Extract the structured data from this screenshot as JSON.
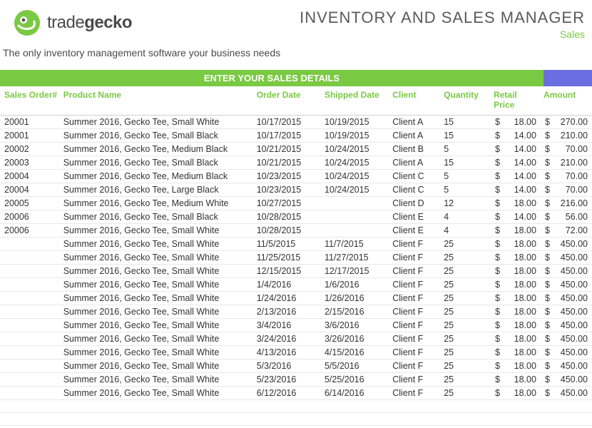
{
  "brand": {
    "name_light": "trade",
    "name_bold": "gecko",
    "tagline": "The only inventory management software your business needs"
  },
  "header": {
    "title": "INVENTORY AND SALES MANAGER",
    "subtitle": "Sales"
  },
  "table": {
    "section_label": "ENTER YOUR SALES DETAILS",
    "columns": {
      "order": "Sales Order#",
      "product": "Product Name",
      "order_date": "Order Date",
      "shipped_date": "Shipped Date",
      "client": "Client",
      "quantity": "Quantity",
      "retail_price": "Retail Price",
      "amount": "Amount"
    },
    "currency": "$",
    "rows": [
      {
        "order": "20001",
        "product": "Summer 2016, Gecko Tee, Small White",
        "order_date": "10/17/2015",
        "shipped_date": "10/19/2015",
        "client": "Client A",
        "qty": "15",
        "price": "18.00",
        "amount": "270.00"
      },
      {
        "order": "20001",
        "product": "Summer 2016, Gecko Tee, Small Black",
        "order_date": "10/17/2015",
        "shipped_date": "10/19/2015",
        "client": "Client A",
        "qty": "15",
        "price": "14.00",
        "amount": "210.00"
      },
      {
        "order": "20002",
        "product": "Summer 2016, Gecko Tee, Medium Black",
        "order_date": "10/21/2015",
        "shipped_date": "10/24/2015",
        "client": "Client B",
        "qty": "5",
        "price": "14.00",
        "amount": "70.00"
      },
      {
        "order": "20003",
        "product": "Summer 2016, Gecko Tee, Small Black",
        "order_date": "10/21/2015",
        "shipped_date": "10/24/2015",
        "client": "Client A",
        "qty": "15",
        "price": "14.00",
        "amount": "210.00"
      },
      {
        "order": "20004",
        "product": "Summer 2016, Gecko Tee, Medium Black",
        "order_date": "10/23/2015",
        "shipped_date": "10/24/2015",
        "client": "Client C",
        "qty": "5",
        "price": "14.00",
        "amount": "70.00"
      },
      {
        "order": "20004",
        "product": "Summer 2016, Gecko Tee, Large Black",
        "order_date": "10/23/2015",
        "shipped_date": "10/24/2015",
        "client": "Client C",
        "qty": "5",
        "price": "14.00",
        "amount": "70.00"
      },
      {
        "order": "20005",
        "product": "Summer 2016, Gecko Tee, Medium White",
        "order_date": "10/27/2015",
        "shipped_date": "",
        "client": "Client D",
        "qty": "12",
        "price": "18.00",
        "amount": "216.00"
      },
      {
        "order": "20006",
        "product": "Summer 2016, Gecko Tee, Small Black",
        "order_date": "10/28/2015",
        "shipped_date": "",
        "client": "Client E",
        "qty": "4",
        "price": "14.00",
        "amount": "56.00"
      },
      {
        "order": "20006",
        "product": "Summer 2016, Gecko Tee, Small White",
        "order_date": "10/28/2015",
        "shipped_date": "",
        "client": "Client E",
        "qty": "4",
        "price": "18.00",
        "amount": "72.00"
      },
      {
        "order": "",
        "product": "Summer 2016, Gecko Tee, Small White",
        "order_date": "11/5/2015",
        "shipped_date": "11/7/2015",
        "client": "Client F",
        "qty": "25",
        "price": "18.00",
        "amount": "450.00"
      },
      {
        "order": "",
        "product": "Summer 2016, Gecko Tee, Small White",
        "order_date": "11/25/2015",
        "shipped_date": "11/27/2015",
        "client": "Client F",
        "qty": "25",
        "price": "18.00",
        "amount": "450.00"
      },
      {
        "order": "",
        "product": "Summer 2016, Gecko Tee, Small White",
        "order_date": "12/15/2015",
        "shipped_date": "12/17/2015",
        "client": "Client F",
        "qty": "25",
        "price": "18.00",
        "amount": "450.00"
      },
      {
        "order": "",
        "product": "Summer 2016, Gecko Tee, Small White",
        "order_date": "1/4/2016",
        "shipped_date": "1/6/2016",
        "client": "Client F",
        "qty": "25",
        "price": "18.00",
        "amount": "450.00"
      },
      {
        "order": "",
        "product": "Summer 2016, Gecko Tee, Small White",
        "order_date": "1/24/2016",
        "shipped_date": "1/26/2016",
        "client": "Client F",
        "qty": "25",
        "price": "18.00",
        "amount": "450.00"
      },
      {
        "order": "",
        "product": "Summer 2016, Gecko Tee, Small White",
        "order_date": "2/13/2016",
        "shipped_date": "2/15/2016",
        "client": "Client F",
        "qty": "25",
        "price": "18.00",
        "amount": "450.00"
      },
      {
        "order": "",
        "product": "Summer 2016, Gecko Tee, Small White",
        "order_date": "3/4/2016",
        "shipped_date": "3/6/2016",
        "client": "Client F",
        "qty": "25",
        "price": "18.00",
        "amount": "450.00"
      },
      {
        "order": "",
        "product": "Summer 2016, Gecko Tee, Small White",
        "order_date": "3/24/2016",
        "shipped_date": "3/26/2016",
        "client": "Client F",
        "qty": "25",
        "price": "18.00",
        "amount": "450.00"
      },
      {
        "order": "",
        "product": "Summer 2016, Gecko Tee, Small White",
        "order_date": "4/13/2016",
        "shipped_date": "4/15/2016",
        "client": "Client F",
        "qty": "25",
        "price": "18.00",
        "amount": "450.00"
      },
      {
        "order": "",
        "product": "Summer 2016, Gecko Tee, Small White",
        "order_date": "5/3/2016",
        "shipped_date": "5/5/2016",
        "client": "Client F",
        "qty": "25",
        "price": "18.00",
        "amount": "450.00"
      },
      {
        "order": "",
        "product": "Summer 2016, Gecko Tee, Small White",
        "order_date": "5/23/2016",
        "shipped_date": "5/25/2016",
        "client": "Client F",
        "qty": "25",
        "price": "18.00",
        "amount": "450.00"
      },
      {
        "order": "",
        "product": "Summer 2016, Gecko Tee, Small White",
        "order_date": "6/12/2016",
        "shipped_date": "6/14/2016",
        "client": "Client F",
        "qty": "25",
        "price": "18.00",
        "amount": "450.00"
      }
    ]
  }
}
